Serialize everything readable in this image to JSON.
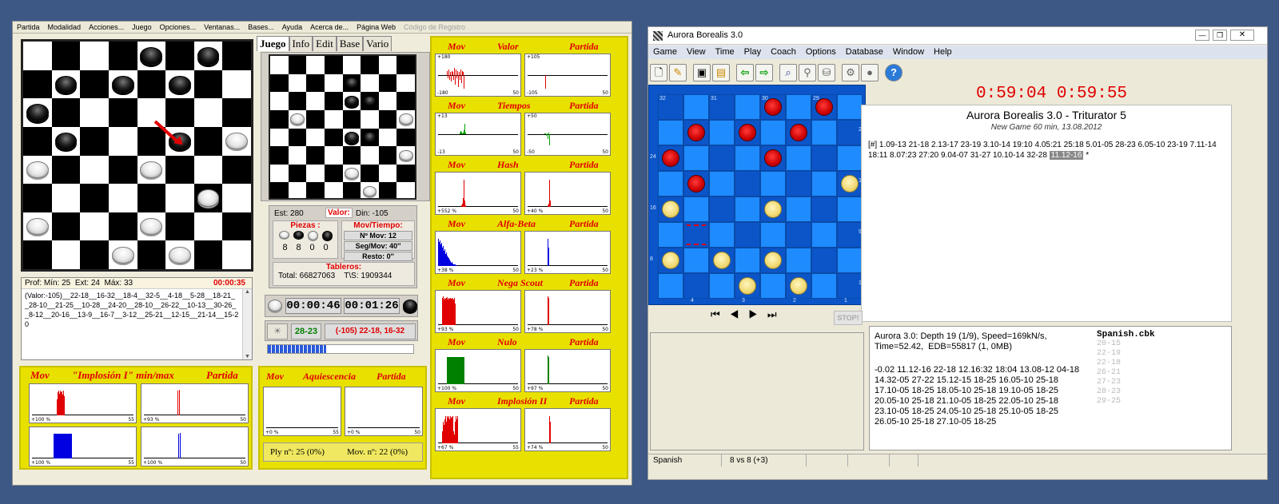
{
  "left_app": {
    "menu": [
      "Partida",
      "Modalidad",
      "Acciones...",
      "Juego",
      "Opciones...",
      "Ventanas...",
      "Bases...",
      "Ayuda",
      "Acerca de...",
      "Página Web",
      "Código de Registro"
    ],
    "tabs": [
      "Juego",
      "Info",
      "Edit",
      "Base",
      "Vario"
    ],
    "search": {
      "prof_min": "Prof: Mín: 25",
      "ext": "Ext: 24",
      "max": "Máx: 33",
      "time": "00:00:35"
    },
    "pv_text": "(Valor:-105)__22-18__16-32__18-4__32-5__4-18__5-28__18-21__28-10__21-25__10-28__24-20__28-10__26-22__10-13__30-26__8-12__20-16__13-9__16-7__3-12__25-21__12-15__21-14__15-20",
    "eval": {
      "est": "Est: 280",
      "valor_label": "Valor:",
      "din": "Din: -105"
    },
    "piezas": {
      "label": "Piezas :",
      "counts": [
        "8",
        "8",
        "0",
        "0"
      ]
    },
    "mov_tiempo": {
      "label": "Mov/Tiempo:",
      "n_mov": "Nº Mov: 12",
      "seg_mov": "Seg/Mov: 40''",
      "resto": "Resto: 0''"
    },
    "tableros": {
      "label": "Tableros:",
      "total": "Total: 66827063",
      "ts": "T\\S: 1909344"
    },
    "clocks": [
      "00:00:46",
      "00:01:26"
    ],
    "last_move": "28-23",
    "best_line": "(-105) 22-18, 16-32",
    "progress_pct": 40,
    "ply_text": "Ply nº: 25 (0%)",
    "mov_text": "Mov. nº: 22 (0%)",
    "chart_panels_right": [
      {
        "mov": "Mov",
        "name": "Valor",
        "partida": "Partida",
        "l_top": "+180",
        "l_bot": "-180",
        "l_end": "50",
        "r_top": "+105",
        "r_bot": "-105",
        "r_end": "50"
      },
      {
        "mov": "Mov",
        "name": "Tiempos",
        "partida": "Partida",
        "l_top": "+13",
        "l_bot": "-13",
        "l_end": "50",
        "r_top": "+50",
        "r_bot": "-50",
        "r_end": "50"
      },
      {
        "mov": "Mov",
        "name": "Hash",
        "partida": "Partida",
        "l_top": "",
        "l_bot": "+552 %",
        "l_end": "50",
        "r_top": "",
        "r_bot": "+40 %",
        "r_end": "50"
      },
      {
        "mov": "Mov",
        "name": "Alfa-Beta",
        "partida": "Partida",
        "l_top": "",
        "l_bot": "+38 %",
        "l_end": "50",
        "r_top": "",
        "r_bot": "+23 %",
        "r_end": "50"
      },
      {
        "mov": "Mov",
        "name": "Nega Scout",
        "partida": "Partida",
        "l_top": "",
        "l_bot": "+93 %",
        "l_end": "50",
        "r_top": "",
        "r_bot": "+78 %",
        "r_end": "50"
      },
      {
        "mov": "Mov",
        "name": "Nulo",
        "partida": "Partida",
        "l_top": "",
        "l_bot": "+100 %",
        "l_end": "50",
        "r_top": "",
        "r_bot": "+97 %",
        "r_end": "50"
      },
      {
        "mov": "Mov",
        "name": "Implosión II",
        "partida": "Partida",
        "l_top": "",
        "l_bot": "+67 %",
        "l_end": "55",
        "r_top": "",
        "r_bot": "+74 %",
        "r_end": "50"
      }
    ],
    "implosion_panel": {
      "mov": "Mov",
      "name": "\"Implosión I\" min/max",
      "partida": "Partida",
      "tl": "+100 %",
      "tl_end": "55",
      "tr": "+93 %",
      "tr_end": "50",
      "bl": "+100 %",
      "bl_end": "55",
      "br": "+100 %",
      "br_end": "50"
    },
    "aquiescencia_panel": {
      "mov": "Mov",
      "name": "Aquiescencia",
      "partida": "Partida",
      "l": "+0 %",
      "l_end": "55",
      "r": "+0 %",
      "r_end": "50"
    }
  },
  "right_app": {
    "title": "Aurora Borealis 3.0",
    "menu": [
      "Game",
      "View",
      "Time",
      "Play",
      "Coach",
      "Options",
      "Database",
      "Window",
      "Help"
    ],
    "clock": "0:59:04  0:59:55",
    "match_title": "Aurora Borealis 3.0 - Triturator 5",
    "match_sub": "New Game 60 min, 13.08.2012",
    "moves": "[#] 1.09-13 21-18 2.13-17 23-19 3.10-14 19:10 4.05:21 25:18 5.01-05 28-23 6.05-10 23-19 7.11-14 18:11 8.07:23 27:20 9.04-07 31-27 10.10-14 32-28",
    "current_move": "11.12-16",
    "current_suffix": "*",
    "engine_info": "Aurora 3.0: Depth 19 (1/9), Speed=169kN/s,\nTime=52.42,  EDB=55817 (1, 0MB)",
    "engine_pv": "-0.02 11.12-16 22-18 12.16:32 18:04 13.08-12 04-18\n14.32-05 27-22 15.12-15 18-25 16.05-10 25-18\n17.10-05 18-25 18.05-10 25-18 19.10-05 18-25\n20.05-10 25-18 21.10-05 18-25 22.05-10 25-18\n23.10-05 18-25 24.05-10 25-18 25.10-05 18-25\n26.05-10 25-18 27.10-05 18-25",
    "book_name": "Spanish.cbk",
    "book_moves": [
      "20-15",
      "22-19",
      "22-18",
      "26-21",
      "27-23",
      "28-23",
      "29-25"
    ],
    "stop_label": "STOP!",
    "status_left": "Spanish",
    "status_mid": "8 vs 8  (+3)",
    "board_labels_top": [
      "32",
      "31",
      "30",
      "29"
    ],
    "board_labels_bottom": [
      "4",
      "3",
      "2",
      "1"
    ],
    "board_labels_left": [
      "24",
      "16",
      "8"
    ],
    "board_labels_right": [
      "25",
      "17",
      "9",
      "1"
    ]
  },
  "colors": {
    "accent_red": "#e00000",
    "yellow_panel": "#e8e100",
    "right_board_light": "#1e8bff",
    "right_board_dark": "#0b55c8"
  }
}
